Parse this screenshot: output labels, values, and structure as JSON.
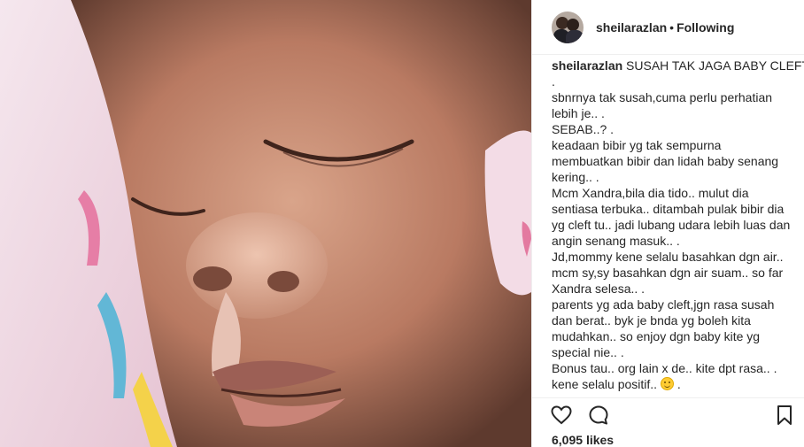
{
  "post": {
    "photo": {
      "alt": ""
    },
    "header": {
      "username": "sheilarazlan",
      "separator": "•",
      "follow_status": "Following"
    },
    "caption": {
      "username": "sheilarazlan",
      "first_line": "SUSAH TAK JAGA BABY CLEFT?",
      "lines": [
        ".",
        "sbnrnya tak susah,cuma perlu perhatian",
        "lebih je.. .",
        "SEBAB..? .",
        "keadaan bibir yg tak sempurna",
        "membuatkan bibir dan lidah baby senang",
        "kering.. .",
        "Mcm Xandra,bila dia tido.. mulut dia",
        "sentiasa terbuka.. ditambah pulak bibir dia",
        "yg cleft tu.. jadi lubang udara lebih luas dan",
        "angin senang masuk.. .",
        "Jd,mommy kene selalu basahkan dgn air..",
        "mcm sy,sy basahkan dgn air suam.. so far",
        "Xandra selesa.. .",
        "parents yg ada baby cleft,jgn rasa susah",
        "dan berat.. byk je bnda yg boleh kita",
        "mudahkan.. so enjoy dgn baby kite yg",
        "special nie.. .",
        "Bonus tau.. org lain x de.. kite dpt rasa.. ."
      ],
      "last_line_text": "kene selalu positif..",
      "last_line_suffix": ".",
      "emoji": "smiling-face-icon"
    },
    "actions": {
      "like_icon": "heart-icon",
      "comment_icon": "comment-icon",
      "save_icon": "bookmark-icon"
    },
    "likes": {
      "count": "6,095",
      "label": "likes"
    }
  }
}
